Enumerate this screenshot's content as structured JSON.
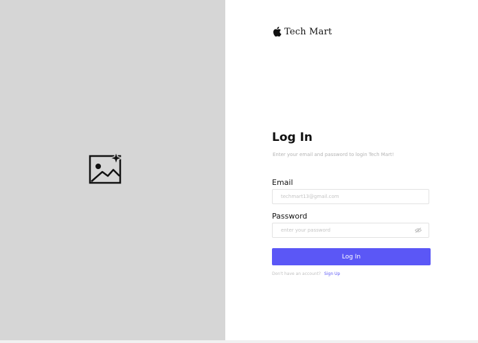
{
  "brand": {
    "name": "Tech Mart",
    "logo_icon": "apple-icon"
  },
  "hero": {
    "icon": "image-sparkle-icon"
  },
  "login": {
    "title": "Log In",
    "subtitle": "Enter your email and password to login Tech Mart!",
    "email_label": "Email",
    "email_placeholder": "techmart13@gmail.com",
    "email_value": "",
    "password_label": "Password",
    "password_placeholder": "enter your password",
    "password_value": "",
    "password_toggle_icon": "eye-off-icon",
    "submit_label": "Log In",
    "signup_prompt": "Don't have an account?",
    "signup_link": "Sign Up"
  },
  "colors": {
    "accent": "#5b57f6",
    "left_panel_bg": "#d6d6d6",
    "muted_text": "#b3b3b3"
  }
}
